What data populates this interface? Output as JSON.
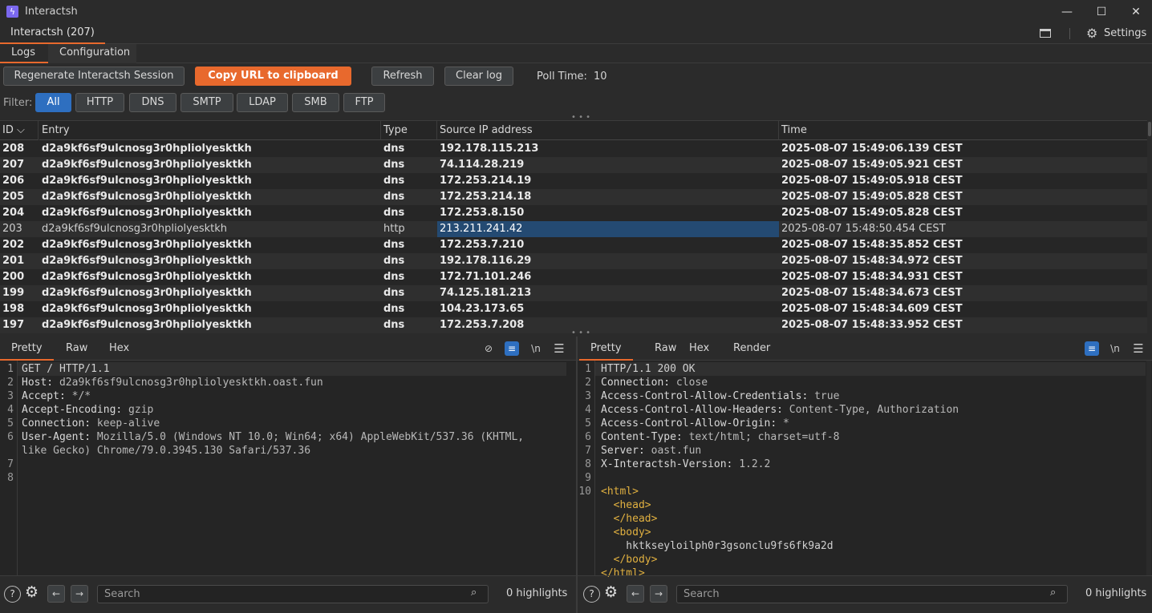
{
  "window": {
    "title": "Interactsh",
    "minimize": "—",
    "maximize": "☐",
    "close": "✕"
  },
  "ext_tab": {
    "label": "Interactsh (207)"
  },
  "top_right": {
    "settings_label": "Settings"
  },
  "subtabs": [
    "Logs",
    "Configuration"
  ],
  "toolbar": {
    "regen": "Regenerate Interactsh Session",
    "copy": "Copy URL to clipboard",
    "refresh": "Refresh",
    "clear": "Clear log",
    "poll_label": "Poll Time:",
    "poll_value": "10"
  },
  "filter": {
    "label": "Filter:",
    "options": [
      "All",
      "HTTP",
      "DNS",
      "SMTP",
      "LDAP",
      "SMB",
      "FTP"
    ],
    "selected": "All"
  },
  "table": {
    "headers": [
      "ID",
      "Entry",
      "Type",
      "Source IP address",
      "Time"
    ],
    "rows": [
      [
        "208",
        "d2a9kf6sf9ulcnosg3r0hpliolyesktkh",
        "dns",
        "192.178.115.213",
        "2025-08-07 15:49:06.139 CEST"
      ],
      [
        "207",
        "d2a9kf6sf9ulcnosg3r0hpliolyesktkh",
        "dns",
        "74.114.28.219",
        "2025-08-07 15:49:05.921 CEST"
      ],
      [
        "206",
        "d2a9kf6sf9ulcnosg3r0hpliolyesktkh",
        "dns",
        "172.253.214.19",
        "2025-08-07 15:49:05.918 CEST"
      ],
      [
        "205",
        "d2a9kf6sf9ulcnosg3r0hpliolyesktkh",
        "dns",
        "172.253.214.18",
        "2025-08-07 15:49:05.828 CEST"
      ],
      [
        "204",
        "d2a9kf6sf9ulcnosg3r0hpliolyesktkh",
        "dns",
        "172.253.8.150",
        "2025-08-07 15:49:05.828 CEST"
      ],
      [
        "203",
        "d2a9kf6sf9ulcnosg3r0hpliolyesktkh",
        "http",
        "213.211.241.42",
        "2025-08-07 15:48:50.454 CEST"
      ],
      [
        "202",
        "d2a9kf6sf9ulcnosg3r0hpliolyesktkh",
        "dns",
        "172.253.7.210",
        "2025-08-07 15:48:35.852 CEST"
      ],
      [
        "201",
        "d2a9kf6sf9ulcnosg3r0hpliolyesktkh",
        "dns",
        "192.178.116.29",
        "2025-08-07 15:48:34.972 CEST"
      ],
      [
        "200",
        "d2a9kf6sf9ulcnosg3r0hpliolyesktkh",
        "dns",
        "172.71.101.246",
        "2025-08-07 15:48:34.931 CEST"
      ],
      [
        "199",
        "d2a9kf6sf9ulcnosg3r0hpliolyesktkh",
        "dns",
        "74.125.181.213",
        "2025-08-07 15:48:34.673 CEST"
      ],
      [
        "198",
        "d2a9kf6sf9ulcnosg3r0hpliolyesktkh",
        "dns",
        "104.23.173.65",
        "2025-08-07 15:48:34.609 CEST"
      ],
      [
        "197",
        "d2a9kf6sf9ulcnosg3r0hpliolyesktkh",
        "dns",
        "172.253.7.208",
        "2025-08-07 15:48:33.952 CEST"
      ]
    ],
    "selected_id": "203"
  },
  "request": {
    "tabs": [
      "Pretty",
      "Raw",
      "Hex"
    ],
    "lines": [
      [
        "GET / HTTP/1.1",
        ""
      ],
      [
        "Host:",
        " d2a9kf6sf9ulcnosg3r0hpliolyesktkh.oast.fun"
      ],
      [
        "Accept:",
        " */*"
      ],
      [
        "Accept-Encoding:",
        " gzip"
      ],
      [
        "Connection:",
        " keep-alive"
      ],
      [
        "User-Agent:",
        " Mozilla/5.0 (Windows NT 10.0; Win64; x64) AppleWebKit/537.36 (KHTML,"
      ],
      [
        "",
        "like Gecko) Chrome/79.0.3945.130 Safari/537.36"
      ],
      [
        "",
        ""
      ],
      [
        "",
        ""
      ]
    ],
    "line_numbers": [
      "1",
      "2",
      "3",
      "4",
      "5",
      "6",
      "",
      "7",
      "8"
    ]
  },
  "response": {
    "tabs": [
      "Pretty",
      "Raw",
      "Hex",
      "Render"
    ],
    "lines": [
      [
        "HTTP/1.1 200 OK",
        ""
      ],
      [
        "Connection:",
        " close"
      ],
      [
        "Access-Control-Allow-Credentials:",
        " true"
      ],
      [
        "Access-Control-Allow-Headers:",
        " Content-Type, Authorization"
      ],
      [
        "Access-Control-Allow-Origin:",
        " *"
      ],
      [
        "Content-Type:",
        " text/html; charset=utf-8"
      ],
      [
        "Server:",
        " oast.fun"
      ],
      [
        "X-Interactsh-Version:",
        " 1.2.2"
      ],
      [
        "",
        ""
      ],
      [
        "<html>",
        ""
      ],
      [
        "  <head>",
        ""
      ],
      [
        "  </head>",
        ""
      ],
      [
        "  <body>",
        ""
      ],
      [
        "    hktkseyloilph0r3gsonclu9fs6fk9a2d",
        ""
      ],
      [
        "  </body>",
        ""
      ],
      [
        "</html>",
        ""
      ]
    ],
    "line_numbers": [
      "1",
      "2",
      "3",
      "4",
      "5",
      "6",
      "7",
      "8",
      "9",
      "10"
    ]
  },
  "footer": {
    "search_placeholder": "Search",
    "highlights": "0 highlights"
  }
}
